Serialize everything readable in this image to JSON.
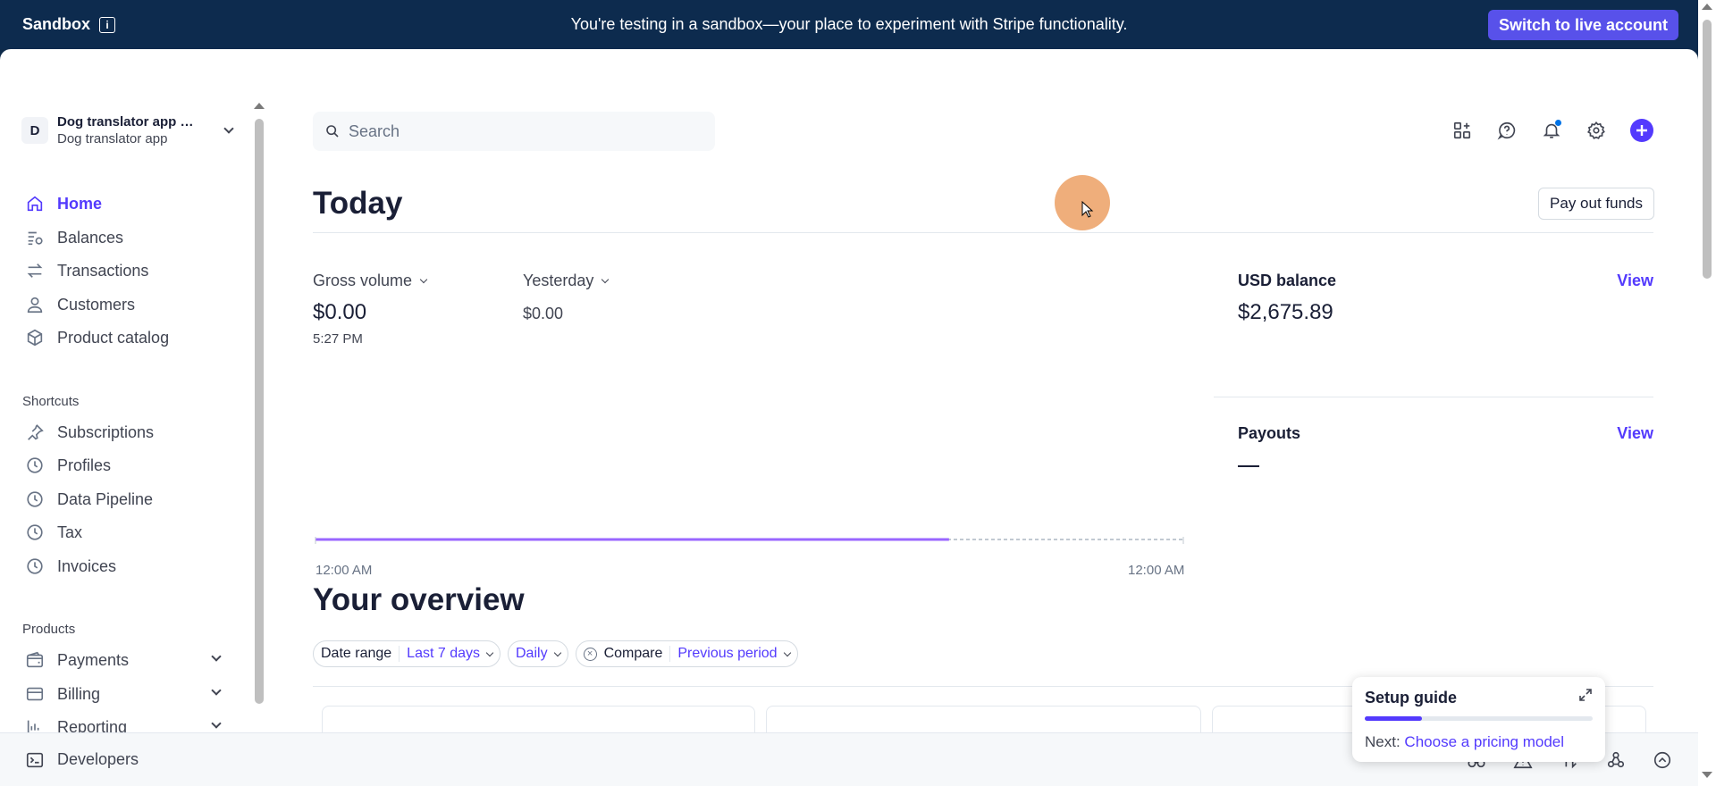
{
  "banner": {
    "env_label": "Sandbox",
    "message": "You're testing in a sandbox—your place to experiment with Stripe functionality.",
    "live_button": "Switch to live account"
  },
  "account": {
    "avatar_letter": "D",
    "name": "Dog translator app sa...",
    "sub": "Dog translator app"
  },
  "nav": {
    "items": [
      {
        "label": "Home",
        "icon": "home-icon"
      },
      {
        "label": "Balances",
        "icon": "balances-icon"
      },
      {
        "label": "Transactions",
        "icon": "transactions-icon"
      },
      {
        "label": "Customers",
        "icon": "customers-icon"
      },
      {
        "label": "Product catalog",
        "icon": "product-catalog-icon"
      }
    ],
    "shortcuts_title": "Shortcuts",
    "shortcuts": [
      {
        "label": "Subscriptions",
        "icon": "pin-icon"
      },
      {
        "label": "Profiles",
        "icon": "clock-icon"
      },
      {
        "label": "Data Pipeline",
        "icon": "clock-icon"
      },
      {
        "label": "Tax",
        "icon": "clock-icon"
      },
      {
        "label": "Invoices",
        "icon": "clock-icon"
      }
    ],
    "products_title": "Products",
    "products": [
      {
        "label": "Payments",
        "icon": "payments-icon"
      },
      {
        "label": "Billing",
        "icon": "billing-icon"
      },
      {
        "label": "Reporting",
        "icon": "reporting-icon"
      }
    ],
    "developers": "Developers"
  },
  "search": {
    "placeholder": "Search"
  },
  "today": {
    "title": "Today",
    "payout_button": "Pay out funds",
    "gross_volume_label": "Gross volume",
    "gross_volume_value": "$0.00",
    "gross_volume_time": "5:27 PM",
    "yesterday_label": "Yesterday",
    "yesterday_value": "$0.00",
    "chart_start": "12:00 AM",
    "chart_end": "12:00 AM",
    "chart_progress": 0.73,
    "usd_balance_label": "USD balance",
    "usd_balance_value": "$2,675.89",
    "payouts_label": "Payouts",
    "view_label": "View"
  },
  "overview": {
    "title": "Your overview",
    "date_range_label": "Date range",
    "date_range_value": "Last 7 days",
    "interval_value": "Daily",
    "compare_label": "Compare",
    "compare_value": "Previous period"
  },
  "setup_guide": {
    "title": "Setup guide",
    "next_label": "Next:",
    "next_link": "Choose a pricing model",
    "progress": 0.25
  },
  "colors": {
    "accent": "#533afd",
    "banner_bg": "#0d2b4e",
    "live_button": "#5851ea"
  }
}
